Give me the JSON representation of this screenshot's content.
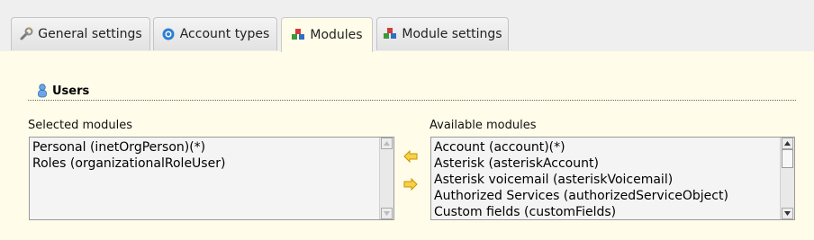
{
  "tabs": [
    {
      "label": "General settings",
      "icon": "wrench-icon",
      "active": false
    },
    {
      "label": "Account types",
      "icon": "gear-icon",
      "active": false
    },
    {
      "label": "Modules",
      "icon": "modules-icon",
      "active": true
    },
    {
      "label": "Module settings",
      "icon": "modules-icon",
      "active": false
    }
  ],
  "section": {
    "title": "Users",
    "icon": "user-icon"
  },
  "selected": {
    "label": "Selected modules",
    "items": [
      "Personal (inetOrgPerson)(*)",
      "Roles (organizationalRoleUser)"
    ]
  },
  "available": {
    "label": "Available modules",
    "items": [
      "Account (account)(*)",
      "Asterisk (asteriskAccount)",
      "Asterisk voicemail (asteriskVoicemail)",
      "Authorized Services (authorizedServiceObject)",
      "Custom fields (customFields)"
    ]
  },
  "buttons": {
    "add": "arrow-left-icon",
    "remove": "arrow-right-icon"
  },
  "colors": {
    "panel": "#fffde9",
    "arrow": "#f2b705"
  }
}
